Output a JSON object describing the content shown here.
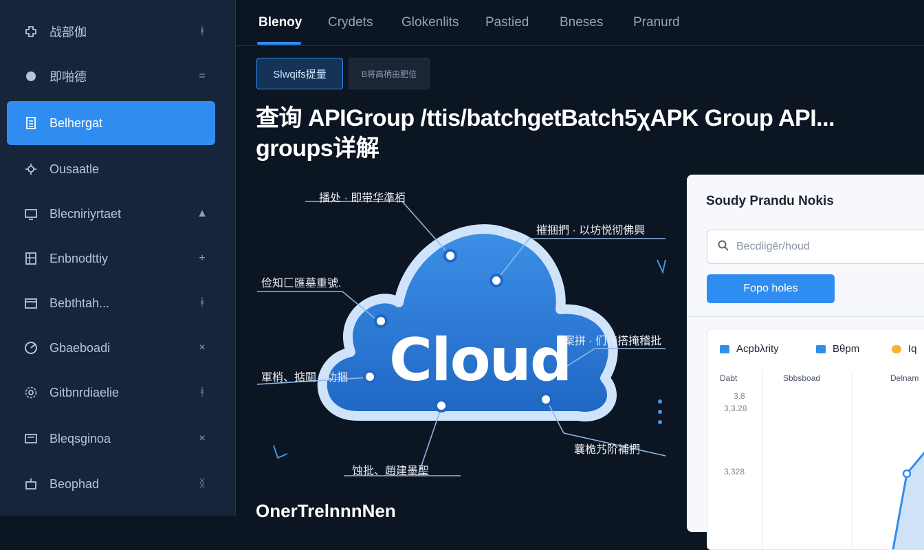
{
  "sidebar": {
    "items": [
      {
        "label": "战部伽",
        "icon": "puzzle-icon",
        "tail": "ᚼ"
      },
      {
        "label": "即啪德",
        "icon": "blob-icon",
        "tail": "="
      },
      {
        "label": "Belhergat",
        "icon": "document-icon",
        "tail": ""
      },
      {
        "label": "Ousaatle",
        "icon": "settings-icon",
        "tail": ""
      },
      {
        "label": "Blecniriyrtaet",
        "icon": "monitor-icon",
        "tail": "▲"
      },
      {
        "label": "Enbnodttiy",
        "icon": "building-icon",
        "tail": "+"
      },
      {
        "label": "Bebthtah...",
        "icon": "calendar-icon",
        "tail": "ᚼ"
      },
      {
        "label": "Gbaeboadi",
        "icon": "chart-pie-icon",
        "tail": "×"
      },
      {
        "label": "Gitbnrdiaelie",
        "icon": "gear-icon",
        "tail": "ᚼ"
      },
      {
        "label": "Bleqsginoa",
        "icon": "folder-icon",
        "tail": "×"
      },
      {
        "label": "Beophad",
        "icon": "box-icon",
        "tail": "ᛝ"
      }
    ]
  },
  "tabs": [
    "Blenoy",
    "Crydets",
    "Glokenlits",
    "Pastied",
    "Bneses",
    "Pranurd"
  ],
  "chips": {
    "a": "Slwqifs提量",
    "b": "В将高柄由肥倍"
  },
  "heading": {
    "line1": "查询 APIGroup /ttis/batchgetBatch5χAPK Group API...",
    "line2": "groups详解"
  },
  "diagram": {
    "center_label": "Cloud",
    "annotations": [
      "播处 · 即带华準栢",
      "摧捆捫 · 以坊悦彻佛興",
      "俭知匚匯墓重號.",
      "案拼 · 们传搭掩稽批",
      "軍梢、掂關 · 功捆",
      "蘘桅艿阶補捫",
      "蚀批、趙建墨聖"
    ]
  },
  "panel": {
    "title": "Soudy Prandu Νokis",
    "search_placeholder": "Becdiigēr/houd",
    "button": "Fopo holes",
    "legend": [
      "Acpbλrity",
      "Bθpm",
      "Iq"
    ],
    "legend_colors": [
      "#2f8df2",
      "#2f8df2",
      "#f2b632"
    ],
    "columns": [
      "Dabt",
      "Sbbsboad",
      "Delnam"
    ],
    "ticks": [
      "3.8",
      "3,3.28",
      "3,328"
    ]
  },
  "bottom_heading": "OnerTrelnnnNen",
  "colors": {
    "accent": "#2f8df2",
    "sidebar": "#16253a",
    "background": "#0c1522"
  }
}
